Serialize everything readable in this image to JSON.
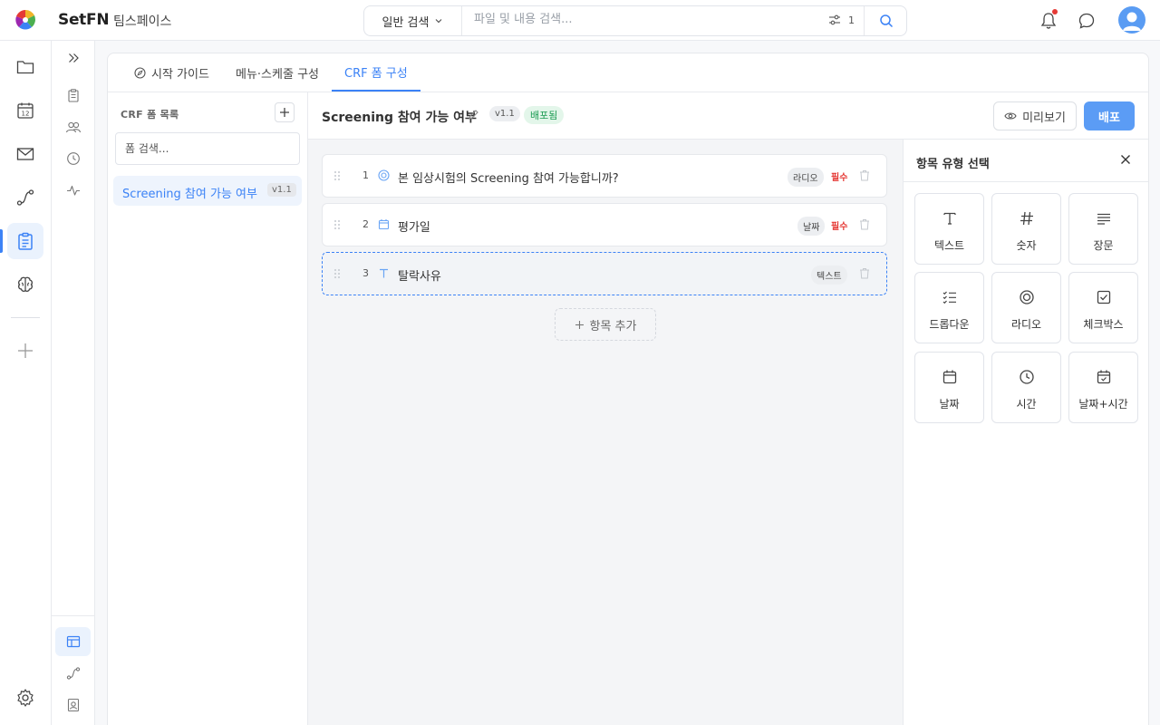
{
  "header": {
    "brand": "SetFN",
    "workspace": "팀스페이스",
    "search_mode": "일반 검색",
    "search_placeholder": "파일 및 내용 검색...",
    "filter_count": "1"
  },
  "rail": {
    "items": [
      "folder-icon",
      "calendar-icon",
      "mail-icon",
      "route-icon",
      "clipboard-icon",
      "brain-icon"
    ],
    "active": "clipboard-icon"
  },
  "rail2": {
    "items": [
      "clipboard-icon",
      "users-icon",
      "clock-icon",
      "activity-icon"
    ],
    "bottom": [
      "layout-icon",
      "route-icon",
      "contact-icon"
    ]
  },
  "tabs": [
    {
      "label": "시작 가이드",
      "active": false
    },
    {
      "label": "메뉴·스케줄 구성",
      "active": false
    },
    {
      "label": "CRF 폼 구성",
      "active": true
    }
  ],
  "formlist": {
    "title": "CRF 폼 목록",
    "search_placeholder": "폼 검색...",
    "items": [
      {
        "name": "Screening 참여 가능 여부",
        "version": "v1.1"
      }
    ]
  },
  "editor": {
    "form_name": "Screening 참여 가능 여부",
    "version": "v1.1",
    "status": "배포됨",
    "preview_label": "미리보기",
    "deploy_label": "배포",
    "add_field_label": "항목 추가",
    "fields": [
      {
        "num": "1",
        "label": "본 임상시험의 Screening 참여 가능합니까?",
        "type": "라디오",
        "required": "필수",
        "icon": "radio-icon"
      },
      {
        "num": "2",
        "label": "평가일",
        "type": "날짜",
        "required": "필수",
        "icon": "calendar-icon"
      },
      {
        "num": "3",
        "label": "탈락사유",
        "type": "텍스트",
        "required": "",
        "icon": "text-icon"
      }
    ]
  },
  "palette": {
    "title": "항목 유형 선택",
    "items": [
      {
        "label": "텍스트",
        "icon": "text-icon"
      },
      {
        "label": "숫자",
        "icon": "hash-icon"
      },
      {
        "label": "장문",
        "icon": "paragraph-icon"
      },
      {
        "label": "드롭다운",
        "icon": "list-check-icon"
      },
      {
        "label": "라디오",
        "icon": "radio-icon"
      },
      {
        "label": "체크박스",
        "icon": "checkbox-icon"
      },
      {
        "label": "날짜",
        "icon": "calendar-icon"
      },
      {
        "label": "시간",
        "icon": "clock-icon"
      },
      {
        "label": "날짜+시간",
        "icon": "calendar-check-icon"
      }
    ]
  },
  "colors": {
    "accent": "#3b82f6",
    "deploy": "#5b9cf5",
    "required": "#e53935",
    "status_green": "#1f9d55"
  }
}
